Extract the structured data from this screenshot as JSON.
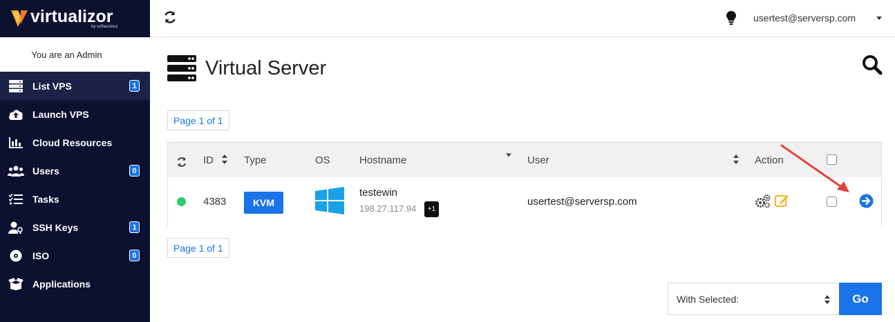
{
  "brand": {
    "name": "virtualizor",
    "sub": "by softaculous"
  },
  "sidebar": {
    "admin_text": "You are an Admin",
    "items": [
      {
        "label": "List VPS",
        "icon": "server-icon",
        "badge": "1",
        "active": true
      },
      {
        "label": "Launch VPS",
        "icon": "cloud-upload-icon",
        "badge": ""
      },
      {
        "label": "Cloud Resources",
        "icon": "bar-chart-icon",
        "badge": ""
      },
      {
        "label": "Users",
        "icon": "users-icon",
        "badge": "0"
      },
      {
        "label": "Tasks",
        "icon": "tasks-icon",
        "badge": ""
      },
      {
        "label": "SSH Keys",
        "icon": "user-key-icon",
        "badge": "1"
      },
      {
        "label": "ISO",
        "icon": "disc-icon",
        "badge": "0"
      },
      {
        "label": "Applications",
        "icon": "box-icon",
        "badge": ""
      }
    ]
  },
  "topbar": {
    "user": "usertest@serversp.com"
  },
  "page": {
    "title": "Virtual Server",
    "pager_top": "Page 1 of 1",
    "pager_bottom": "Page 1 of 1"
  },
  "table": {
    "headers": {
      "id": "ID",
      "type": "Type",
      "os": "OS",
      "hostname": "Hostname",
      "user": "User",
      "action": "Action"
    },
    "rows": [
      {
        "status": "online",
        "id": "4383",
        "type": "KVM",
        "os": "windows-icon",
        "hostname": "testewin",
        "ip": "198.27.117.94",
        "extra_ips": "+1",
        "user": "usertest@serversp.com"
      }
    ]
  },
  "bulk": {
    "select_label": "With Selected:",
    "go_label": "Go"
  },
  "colors": {
    "sidebar_bg": "#0d1130",
    "accent": "#1a73e8",
    "online": "#2ecc71",
    "annotation": "#e0413a"
  }
}
